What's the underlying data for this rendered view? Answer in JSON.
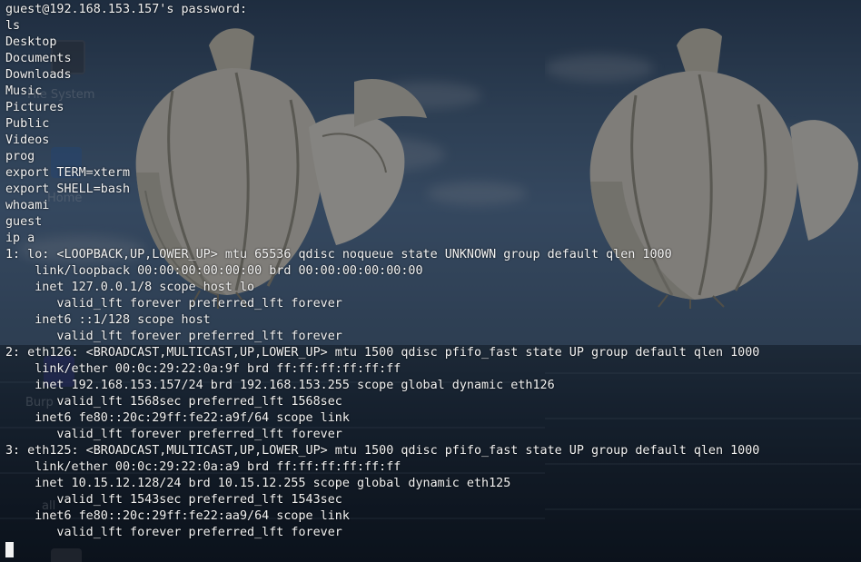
{
  "wallpaper": {
    "description_icon": "garlic-wallpaper-icon",
    "colors": {
      "sky": "#4a6786",
      "sea": "#1f2f40",
      "garlic_light": "#e8e3d6",
      "garlic_shadow": "#8f8a7c"
    }
  },
  "desktop": {
    "icons": [
      {
        "icon": "disk-icon",
        "label": "File System"
      },
      {
        "icon": "home-folder-icon",
        "label": "Home"
      },
      {
        "icon": "app-icon",
        "label": "Burp"
      },
      {
        "icon": "app-icon",
        "label": "all"
      }
    ]
  },
  "terminal": {
    "text_color": "#f2f2f2",
    "lines": [
      "guest@192.168.153.157's password:",
      "ls",
      "Desktop",
      "Documents",
      "Downloads",
      "Music",
      "Pictures",
      "Public",
      "Videos",
      "prog",
      "export TERM=xterm",
      "export SHELL=bash",
      "whoami",
      "guest",
      "ip a",
      "1: lo: <LOOPBACK,UP,LOWER_UP> mtu 65536 qdisc noqueue state UNKNOWN group default qlen 1000",
      "    link/loopback 00:00:00:00:00:00 brd 00:00:00:00:00:00",
      "    inet 127.0.0.1/8 scope host lo",
      "       valid_lft forever preferred_lft forever",
      "    inet6 ::1/128 scope host",
      "       valid_lft forever preferred_lft forever",
      "2: eth126: <BROADCAST,MULTICAST,UP,LOWER_UP> mtu 1500 qdisc pfifo_fast state UP group default qlen 1000",
      "    link/ether 00:0c:29:22:0a:9f brd ff:ff:ff:ff:ff:ff",
      "    inet 192.168.153.157/24 brd 192.168.153.255 scope global dynamic eth126",
      "       valid_lft 1568sec preferred_lft 1568sec",
      "    inet6 fe80::20c:29ff:fe22:a9f/64 scope link",
      "       valid_lft forever preferred_lft forever",
      "3: eth125: <BROADCAST,MULTICAST,UP,LOWER_UP> mtu 1500 qdisc pfifo_fast state UP group default qlen 1000",
      "    link/ether 00:0c:29:22:0a:a9 brd ff:ff:ff:ff:ff:ff",
      "    inet 10.15.12.128/24 brd 10.15.12.255 scope global dynamic eth125",
      "       valid_lft 1543sec preferred_lft 1543sec",
      "    inet6 fe80::20c:29ff:fe22:aa9/64 scope link",
      "       valid_lft forever preferred_lft forever"
    ]
  }
}
